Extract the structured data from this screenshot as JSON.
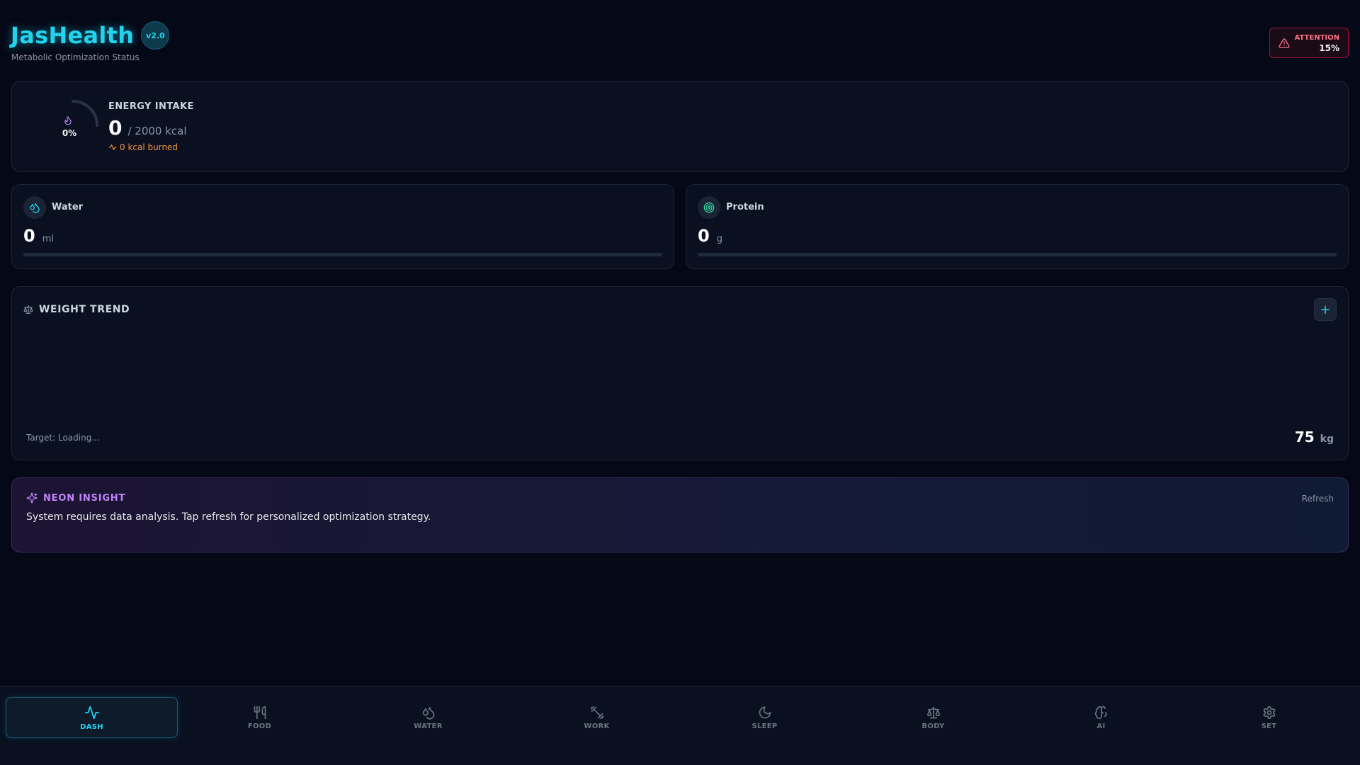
{
  "header": {
    "title": "JasHealth",
    "version": "v2.0",
    "subtitle": "Metabolic Optimization Status",
    "alert": {
      "label": "ATTENTION",
      "value": "15%"
    }
  },
  "energy": {
    "title": "ENERGY INTAKE",
    "percent": "0%",
    "progress": 0,
    "value": "0",
    "goal": "/ 2000 kcal",
    "burned": "0 kcal burned"
  },
  "metrics": [
    {
      "name": "Water",
      "value": "0",
      "unit": "ml",
      "progress": 0,
      "icon": "water-drops-icon"
    },
    {
      "name": "Protein",
      "value": "0",
      "unit": "g",
      "progress": 0,
      "icon": "target-icon"
    }
  ],
  "weight": {
    "title": "WEIGHT TREND",
    "add_label": "+",
    "target": "Target: Loading...",
    "current": "75",
    "unit": "kg"
  },
  "insight": {
    "title": "NEON INSIGHT",
    "refresh_label": "Refresh",
    "message": "System requires data analysis. Tap refresh for personalized optimization strategy."
  },
  "nav": [
    {
      "label": "DASH",
      "icon": "activity-icon",
      "active": true
    },
    {
      "label": "FOOD",
      "icon": "utensils-icon",
      "active": false
    },
    {
      "label": "WATER",
      "icon": "droplets-icon",
      "active": false
    },
    {
      "label": "WORK",
      "icon": "dumbbell-icon",
      "active": false
    },
    {
      "label": "SLEEP",
      "icon": "moon-icon",
      "active": false
    },
    {
      "label": "BODY",
      "icon": "scale-icon",
      "active": false
    },
    {
      "label": "AI",
      "icon": "brain-icon",
      "active": false
    },
    {
      "label": "SET",
      "icon": "settings-icon",
      "active": false
    }
  ],
  "colors": {
    "accent": "#22d3ee",
    "background": "#050816",
    "alert": "#fb7185",
    "insight": "#c084fc",
    "burned": "#fb923c"
  }
}
